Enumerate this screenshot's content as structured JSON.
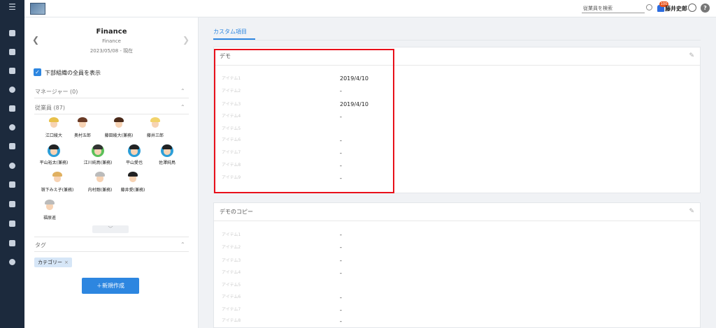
{
  "topbar": {
    "search_placeholder": "従業員を検索",
    "notification_count": "100",
    "username": "藤井史郎",
    "help_label": "?"
  },
  "rail": {
    "menu_icon": "☰",
    "icons": [
      "home-icon",
      "org-chart-icon",
      "document-icon",
      "search-icon",
      "chat-icon",
      "link-icon",
      "chart-icon",
      "info-icon",
      "contacts-icon",
      "book-icon",
      "mail-icon",
      "download-icon",
      "user-settings-icon"
    ]
  },
  "org": {
    "title": "Finance",
    "subtitle": "Finance",
    "date": "2023/05/08 - 現在"
  },
  "options": {
    "show_all_label": "下部組織の全員を表示"
  },
  "sections": {
    "manager": "マネージャー (0)",
    "employees": "従業員 (87)",
    "tags": "タグ"
  },
  "people": [
    {
      "name": "江口綾大",
      "hair": "#e8c04a",
      "bg": "#ffffff"
    },
    {
      "name": "奥村五郎",
      "hair": "#6a3b26",
      "bg": "#ffffff"
    },
    {
      "name": "藤田綾大(兼務)",
      "hair": "#4a2a1a",
      "bg": "#ffffff"
    },
    {
      "name": "藤井三郎",
      "hair": "#f2d36b",
      "bg": "#ffffff"
    },
    {
      "name": "平山裕太(兼務)",
      "hair": "#222222",
      "bg": "#2d9fd8"
    },
    {
      "name": "江川純鳥(兼務)",
      "hair": "#333333",
      "bg": "#5cc05a"
    },
    {
      "name": "平山愛也",
      "hair": "#222222",
      "bg": "#2d9fd8"
    },
    {
      "name": "佐澤純鳥",
      "hair": "#222222",
      "bg": "#2d9fd8"
    },
    {
      "name": "嶺下みえ子(兼務)",
      "hair": "#e0b060",
      "bg": "#ffffff"
    },
    {
      "name": "内村剛(兼務)",
      "hair": "#bbbbbb",
      "bg": "#ffffff"
    },
    {
      "name": "藤井愛(兼務)",
      "hair": "#222222",
      "bg": "#ffffff"
    },
    {
      "name": "福原遥",
      "hair": "#bbbbbb",
      "bg": "#ffffff"
    }
  ],
  "expand_label": "﹀",
  "tag": {
    "label": "カテゴリー",
    "remove": "×"
  },
  "new_button": "＋新規作成",
  "tabs": {
    "custom_items": "カスタム項目"
  },
  "cards": [
    {
      "title": "デモ",
      "rows": [
        {
          "label": "アイテム1",
          "value": "2019/4/10"
        },
        {
          "label": "アイテム2",
          "value": "-"
        },
        {
          "label": "アイテム3",
          "value": "2019/4/10"
        },
        {
          "label": "アイテム4",
          "value": "-"
        },
        {
          "label": "アイテム5",
          "value": ""
        },
        {
          "label": "アイテム6",
          "value": "-"
        },
        {
          "label": "アイテム7",
          "value": "-"
        },
        {
          "label": "アイテム8",
          "value": "-"
        },
        {
          "label": "アイテム9",
          "value": "-"
        }
      ]
    },
    {
      "title": "デモのコピー",
      "rows": [
        {
          "label": "アイテム1",
          "value": "-"
        },
        {
          "label": "アイテム2",
          "value": "-"
        },
        {
          "label": "アイテム3",
          "value": "-"
        },
        {
          "label": "アイテム4",
          "value": "-"
        },
        {
          "label": "アイテム5",
          "value": ""
        },
        {
          "label": "アイテム6",
          "value": "-"
        },
        {
          "label": "アイテム7",
          "value": "-"
        },
        {
          "label": "アイテム8",
          "value": "-"
        }
      ]
    }
  ],
  "colors": {
    "accent": "#2d86e0",
    "rail": "#1c2a3d",
    "highlight": "#e8101a"
  }
}
